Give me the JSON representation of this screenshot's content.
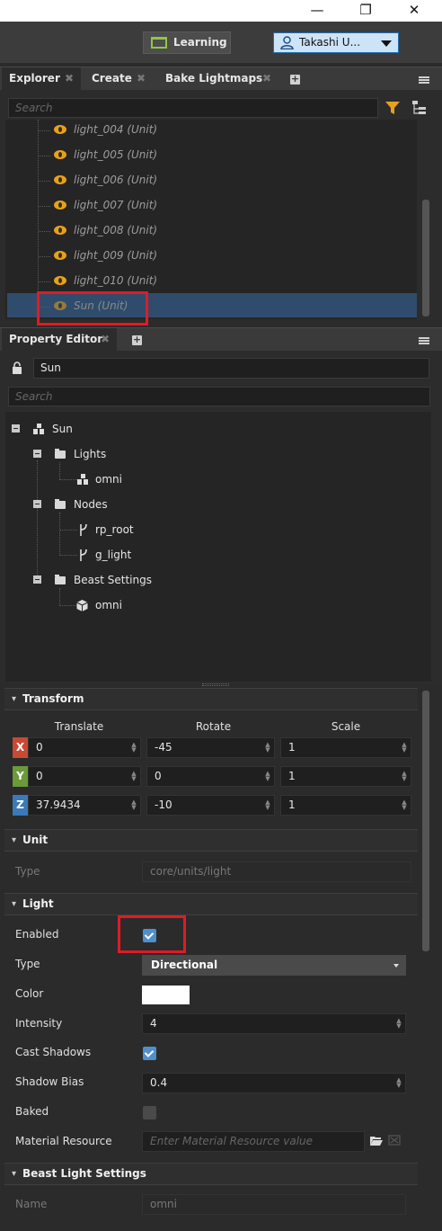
{
  "titlebar": {
    "minimize": "—",
    "restore": "❐",
    "close": "✕"
  },
  "topbar": {
    "learning_label": "Learning",
    "user_label": "Takashi U..."
  },
  "explorer_tabs": [
    {
      "label": "Explorer",
      "close": "✖"
    },
    {
      "label": "Create",
      "close": "✖"
    },
    {
      "label": "Bake Lightmaps",
      "close": "✖"
    }
  ],
  "explorer": {
    "search_placeholder": "Search",
    "items": [
      "light_004 (Unit)",
      "light_005 (Unit)",
      "light_006 (Unit)",
      "light_007 (Unit)",
      "light_008 (Unit)",
      "light_009 (Unit)",
      "light_010 (Unit)",
      "Sun (Unit)"
    ],
    "filter_color": "#e6a11c"
  },
  "property_tab": {
    "label": "Property Editor",
    "close": "✖"
  },
  "property": {
    "name_value": "Sun",
    "search_placeholder": "Search",
    "tree": {
      "root": "Sun",
      "lights_folder": "Lights",
      "lights_child": "omni",
      "nodes_folder": "Nodes",
      "node_1": "rp_root",
      "node_2": "g_light",
      "beast_folder": "Beast Settings",
      "beast_child": "omni"
    }
  },
  "transform": {
    "title": "Transform",
    "col_translate": "Translate",
    "col_rotate": "Rotate",
    "col_scale": "Scale",
    "rows": [
      {
        "axis": "X",
        "translate": "0",
        "rotate": "-45",
        "scale": "1",
        "color": "#c84a32"
      },
      {
        "axis": "Y",
        "translate": "0",
        "rotate": "0",
        "scale": "1",
        "color": "#6a9a3a"
      },
      {
        "axis": "Z",
        "translate": "37.9434",
        "rotate": "-10",
        "scale": "1",
        "color": "#3a7ab8"
      }
    ]
  },
  "unit": {
    "title": "Unit",
    "type_label": "Type",
    "type_value": "core/units/light"
  },
  "light": {
    "title": "Light",
    "enabled_label": "Enabled",
    "enabled": true,
    "type_label": "Type",
    "type_value": "Directional",
    "color_label": "Color",
    "color_value": "#ffffff",
    "intensity_label": "Intensity",
    "intensity_value": "4",
    "cast_shadows_label": "Cast Shadows",
    "cast_shadows": true,
    "shadow_bias_label": "Shadow Bias",
    "shadow_bias_value": "0.4",
    "baked_label": "Baked",
    "baked": false,
    "material_label": "Material Resource",
    "material_placeholder": "Enter Material Resource value"
  },
  "beast": {
    "title": "Beast Light Settings",
    "name_label": "Name",
    "name_value": "omni"
  },
  "colors": {
    "highlight": "#e01b24",
    "selection": "#2f4c6c",
    "accent": "#4f8fcc"
  }
}
